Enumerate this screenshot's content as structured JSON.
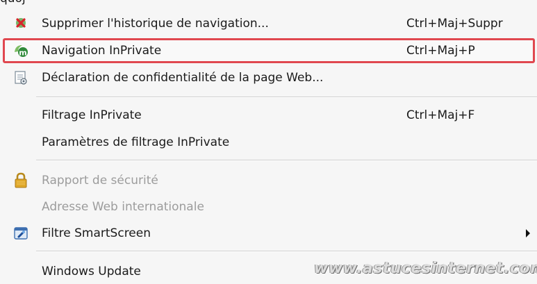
{
  "menu": {
    "top_partial_text": "quoj",
    "items": [
      {
        "label": "Supprimer l'historique de navigation...",
        "shortcut": "Ctrl+Maj+Suppr",
        "icon": "delete-history-icon",
        "enabled": true
      },
      {
        "label": "Navigation InPrivate",
        "shortcut": "Ctrl+Maj+P",
        "icon": "inprivate-icon",
        "enabled": true,
        "highlighted": true
      },
      {
        "label": "Déclaration de confidentialité de la page Web...",
        "shortcut": "",
        "icon": "privacy-report-icon",
        "enabled": true
      },
      {
        "label": "Filtrage InPrivate",
        "shortcut": "Ctrl+Maj+F",
        "icon": "",
        "enabled": true
      },
      {
        "label": "Paramètres de filtrage InPrivate",
        "shortcut": "",
        "icon": "",
        "enabled": true
      },
      {
        "label": "Rapport de sécurité",
        "shortcut": "",
        "icon": "lock-icon",
        "enabled": false
      },
      {
        "label": "Adresse Web internationale",
        "shortcut": "",
        "icon": "",
        "enabled": false
      },
      {
        "label": "Filtre SmartScreen",
        "shortcut": "",
        "icon": "smartscreen-icon",
        "enabled": true,
        "submenu": true
      },
      {
        "label": "Windows Update",
        "shortcut": "",
        "icon": "",
        "enabled": true
      }
    ]
  },
  "watermark": "www.astucesinternet.com",
  "colors": {
    "highlight_border": "#e0474f",
    "disabled_text": "#9c9c9c",
    "background": "#f6f6f6"
  }
}
